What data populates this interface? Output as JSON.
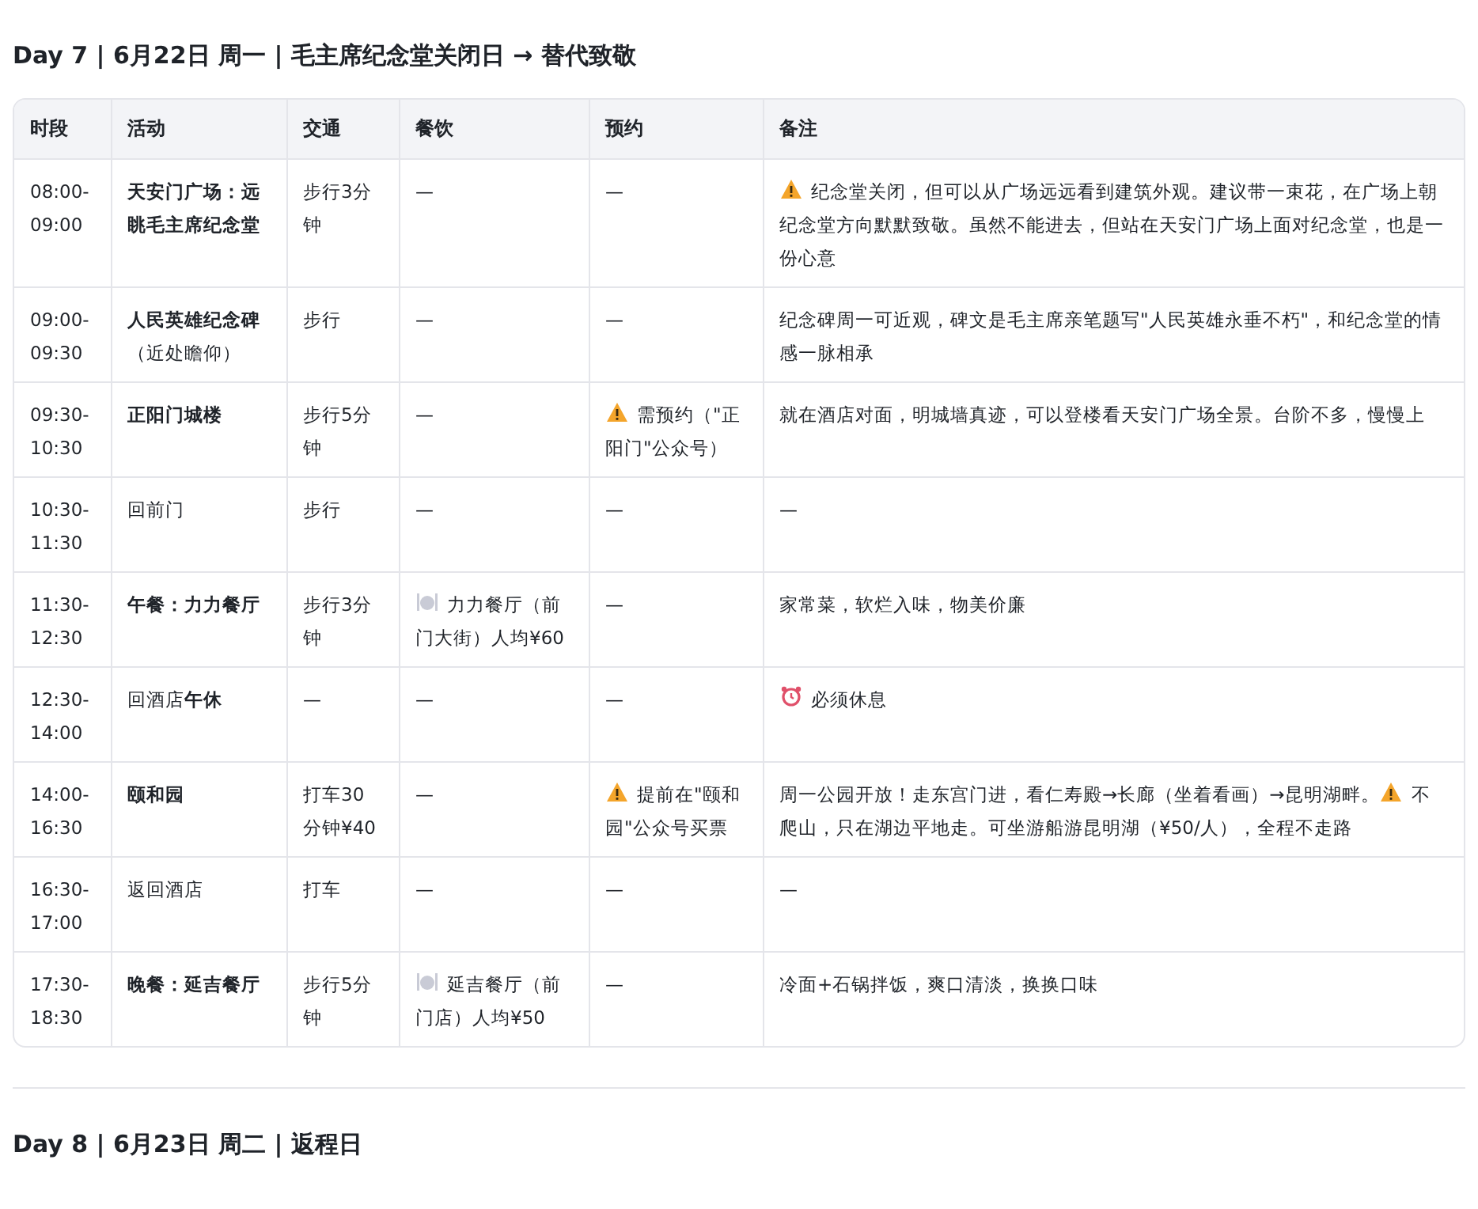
{
  "day_sections": [
    {
      "title": "Day 7 | 6月22日 周一 | 毛主席纪念堂关闭日 → 替代致敬",
      "table": {
        "columns": [
          "时段",
          "活动",
          "交通",
          "餐饮",
          "预约",
          "备注"
        ],
        "rows": [
          {
            "time": "08:00-09:00",
            "activity": {
              "text": "天安门广场：远眺毛主席纪念堂",
              "bold": true
            },
            "transport": "步行3分钟",
            "dining": [
              {
                "kind": "text",
                "text": "—"
              }
            ],
            "booking": [
              {
                "kind": "text",
                "text": "—"
              }
            ],
            "notes": [
              {
                "kind": "warning"
              },
              {
                "kind": "text",
                "text": "纪念堂关闭，但可以从广场远远看到建筑外观。建议带一束花，在广场上朝纪念堂方向默默致敬。虽然不能进去，但站在天安门广场上面对纪念堂，也是一份心意"
              }
            ]
          },
          {
            "time": "09:00-09:30",
            "activity": {
              "text": "**人民英雄纪念碑**（近处瞻仰）",
              "bold": false
            },
            "transport": "步行",
            "dining": [
              {
                "kind": "text",
                "text": "—"
              }
            ],
            "booking": [
              {
                "kind": "text",
                "text": "—"
              }
            ],
            "notes": [
              {
                "kind": "text",
                "text": "纪念碑周一可近观，碑文是毛主席亲笔题写\"人民英雄永垂不朽\"，和纪念堂的情感一脉相承"
              }
            ]
          },
          {
            "time": "09:30-10:30",
            "activity": {
              "text": "正阳门城楼",
              "bold": true
            },
            "transport": "步行5分钟",
            "dining": [
              {
                "kind": "text",
                "text": "—"
              }
            ],
            "booking": [
              {
                "kind": "warning"
              },
              {
                "kind": "text",
                "text": "需预约（\"正阳门\"公众号）"
              }
            ],
            "notes": [
              {
                "kind": "text",
                "text": "就在酒店对面，明城墙真迹，可以登楼看天安门广场全景。台阶不多，慢慢上"
              }
            ]
          },
          {
            "time": "10:30-11:30",
            "activity": {
              "text": "回前门",
              "bold": false
            },
            "transport": "步行",
            "dining": [
              {
                "kind": "text",
                "text": "—"
              }
            ],
            "booking": [
              {
                "kind": "text",
                "text": "—"
              }
            ],
            "notes": [
              {
                "kind": "text",
                "text": "—"
              }
            ]
          },
          {
            "time": "11:30-12:30",
            "activity": {
              "text": "午餐：力力餐厅",
              "bold": true
            },
            "transport": "步行3分钟",
            "dining": [
              {
                "kind": "dish"
              },
              {
                "kind": "text",
                "text": "力力餐厅（前门大街）人均¥60"
              }
            ],
            "booking": [
              {
                "kind": "text",
                "text": "—"
              }
            ],
            "notes": [
              {
                "kind": "text",
                "text": "家常菜，软烂入味，物美价廉"
              }
            ]
          },
          {
            "time": "12:30-14:00",
            "activity": {
              "text": "回酒店**午休**",
              "bold": false
            },
            "transport": "—",
            "dining": [
              {
                "kind": "text",
                "text": "—"
              }
            ],
            "booking": [
              {
                "kind": "text",
                "text": "—"
              }
            ],
            "notes": [
              {
                "kind": "alarm"
              },
              {
                "kind": "text",
                "text": "必须休息"
              }
            ]
          },
          {
            "time": "14:00-16:30",
            "activity": {
              "text": "颐和园",
              "bold": true
            },
            "transport": "打车30分钟¥40",
            "dining": [
              {
                "kind": "text",
                "text": "—"
              }
            ],
            "booking": [
              {
                "kind": "warning"
              },
              {
                "kind": "text",
                "text": "提前在\"颐和园\"公众号买票"
              }
            ],
            "notes": [
              {
                "kind": "text",
                "text": "周一公园开放！走东宫门进，看仁寿殿→长廊（坐着看画）→昆明湖畔。"
              },
              {
                "kind": "warning"
              },
              {
                "kind": "text",
                "text": "不爬山，只在湖边平地走。可坐游船游昆明湖（¥50/人），全程不走路"
              }
            ]
          },
          {
            "time": "16:30-17:00",
            "activity": {
              "text": "返回酒店",
              "bold": false
            },
            "transport": "打车",
            "dining": [
              {
                "kind": "text",
                "text": "—"
              }
            ],
            "booking": [
              {
                "kind": "text",
                "text": "—"
              }
            ],
            "notes": [
              {
                "kind": "text",
                "text": "—"
              }
            ]
          },
          {
            "time": "17:30-18:30",
            "activity": {
              "text": "晚餐：延吉餐厅",
              "bold": true
            },
            "transport": "步行5分钟",
            "dining": [
              {
                "kind": "dish"
              },
              {
                "kind": "text",
                "text": "延吉餐厅（前门店）人均¥50"
              }
            ],
            "booking": [
              {
                "kind": "text",
                "text": "—"
              }
            ],
            "notes": [
              {
                "kind": "text",
                "text": "冷面+石锅拌饭，爽口清淡，换换口味"
              }
            ]
          }
        ]
      }
    },
    {
      "title": "Day 8 | 6月23日 周二 | 返程日"
    }
  ]
}
